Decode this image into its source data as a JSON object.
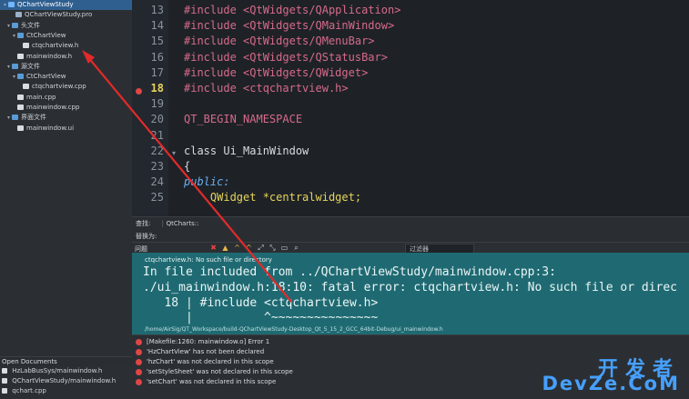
{
  "project_tree": {
    "rows": [
      {
        "label": "QChartViewStudy",
        "icon": "project-icon",
        "twisty": "▾",
        "selected": true
      },
      {
        "label": "QChartViewStudy.pro",
        "icon": "pro-file-icon",
        "twisty": ""
      },
      {
        "label": "头文件",
        "icon": "folder-icon",
        "twisty": "▾"
      },
      {
        "label": "CtChartView",
        "icon": "folder-icon",
        "twisty": "▾"
      },
      {
        "label": "ctqchartview.h",
        "icon": "file-icon",
        "twisty": ""
      },
      {
        "label": "mainwindow.h",
        "icon": "file-icon",
        "twisty": ""
      },
      {
        "label": "源文件",
        "icon": "folder-icon",
        "twisty": "▾"
      },
      {
        "label": "CtChartView",
        "icon": "folder-icon",
        "twisty": "▾"
      },
      {
        "label": "ctqchartview.cpp",
        "icon": "file-icon",
        "twisty": ""
      },
      {
        "label": "main.cpp",
        "icon": "file-icon",
        "twisty": ""
      },
      {
        "label": "mainwindow.cpp",
        "icon": "file-icon",
        "twisty": ""
      },
      {
        "label": "界面文件",
        "icon": "folder-icon",
        "twisty": "▾"
      },
      {
        "label": "mainwindow.ui",
        "icon": "file-icon",
        "twisty": ""
      }
    ]
  },
  "open_documents": {
    "title": "Open Documents",
    "items": [
      "HzLabBusSys/mainwindow.h",
      "QChartViewStudy/mainwindow.h",
      "qchart.cpp"
    ]
  },
  "editor": {
    "lines": [
      {
        "n": "13",
        "text": "#include <QtWidgets/QApplication>"
      },
      {
        "n": "14",
        "text": "#include <QtWidgets/QMainWindow>"
      },
      {
        "n": "15",
        "text": "#include <QtWidgets/QMenuBar>"
      },
      {
        "n": "16",
        "text": "#include <QtWidgets/QStatusBar>"
      },
      {
        "n": "17",
        "text": "#include <QtWidgets/QWidget>"
      },
      {
        "n": "18",
        "text": "#include <ctqchartview.h>"
      },
      {
        "n": "19",
        "text": ""
      },
      {
        "n": "20",
        "text": "QT_BEGIN_NAMESPACE"
      },
      {
        "n": "21",
        "text": ""
      },
      {
        "n": "22",
        "text": "class Ui_MainWindow"
      },
      {
        "n": "23",
        "text": "{"
      },
      {
        "n": "24",
        "text": "public:"
      },
      {
        "n": "25",
        "text": "    QWidget *centralwidget;"
      }
    ]
  },
  "find_bar": {
    "find_label": "查找:",
    "qtcharts_tag": "QtCharts::",
    "replace_label": "替换为:"
  },
  "issues": {
    "title": "问题",
    "filter_placeholder": "过滤器"
  },
  "terminal": {
    "title": "ctqchartview.h: No such file or directory",
    "line1": "In file included from ../QChartViewStudy/mainwindow.cpp:3:",
    "line2": "./ui_mainwindow.h:18:10: fatal error: ctqchartview.h: No such file or direc",
    "line3": "   18 | #include <ctqchartview.h>",
    "line4": "      |          ^~~~~~~~~~~~~~~~",
    "path": "/home/AirSig/QT_Workspace/build-QChartViewStudy-Desktop_Qt_5_15_2_GCC_64bit-Debug/ui_mainwindow.h"
  },
  "issue_list": [
    "[Makefile:1260: mainwindow.o] Error 1",
    "'HzChartView'    has not been declared",
    "'hzChart'    was not declared in this scope",
    "'setStyleSheet'    was not declared in this scope",
    "'setChart'    was not declared in this scope"
  ],
  "watermark": {
    "cn": "开发者",
    "en": "DevZe.CoM"
  },
  "colors": {
    "accent": "#46a0ff",
    "error": "#e04545",
    "terminal_bg": "#1f6a72",
    "selected_row": "#2f5f8f"
  }
}
